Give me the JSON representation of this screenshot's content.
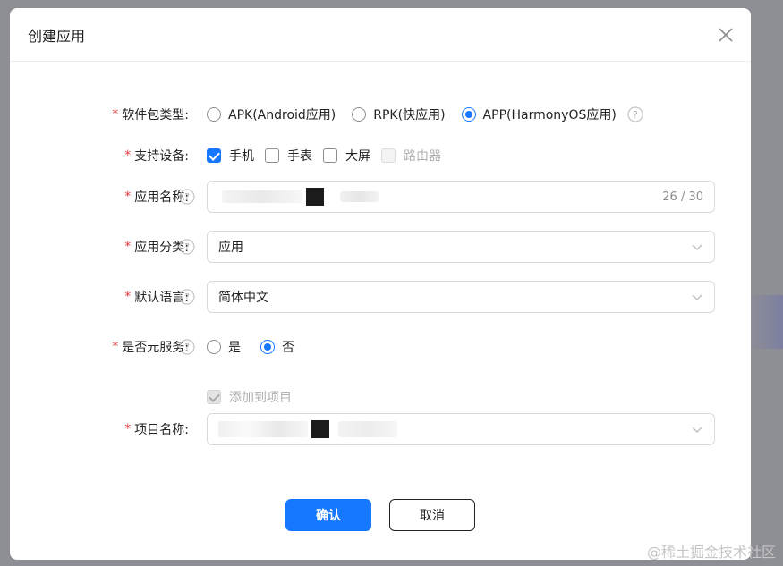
{
  "dialog": {
    "title": "创建应用",
    "close_icon": "close-icon"
  },
  "form": {
    "package_type": {
      "label": "软件包类型:",
      "options": [
        "APK(Android应用)",
        "RPK(快应用)",
        "APP(HarmonyOS应用)"
      ],
      "selected": "APP(HarmonyOS应用)"
    },
    "devices": {
      "label": "支持设备:",
      "options": [
        "手机",
        "手表",
        "大屏",
        "路由器"
      ],
      "checked": [
        "手机"
      ],
      "disabled": [
        "路由器"
      ]
    },
    "app_name": {
      "label": "应用名称:",
      "counter": "26 / 30"
    },
    "category": {
      "label": "应用分类:",
      "value": "应用"
    },
    "language": {
      "label": "默认语言:",
      "value": "简体中文"
    },
    "meta_service": {
      "label": "是否元服务:",
      "options": [
        "是",
        "否"
      ],
      "selected": "否"
    },
    "add_to_project": {
      "label": "添加到项目",
      "checked": true,
      "disabled": true
    },
    "project_name": {
      "label": "项目名称:"
    }
  },
  "footer": {
    "confirm_label": "确认",
    "cancel_label": "取消"
  },
  "watermark": "@稀土掘金技术社区",
  "colors": {
    "accent": "#1677ff",
    "required": "#e8383d",
    "backdrop": "#8e8f95"
  }
}
